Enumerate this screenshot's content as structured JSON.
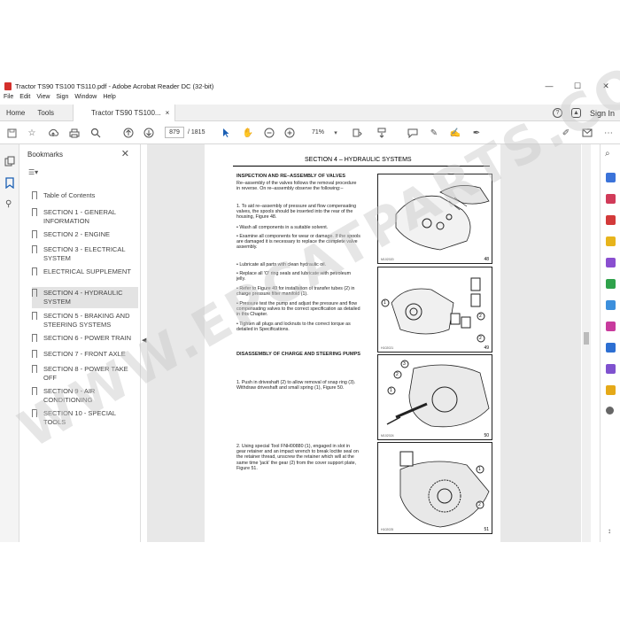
{
  "window": {
    "title": "Tractor TS90 TS100 TS110.pdf - Adobe Acrobat Reader DC (32-bit)",
    "controls": [
      "—",
      "☐",
      "✕"
    ]
  },
  "menu": [
    "File",
    "Edit",
    "View",
    "Sign",
    "Window",
    "Help"
  ],
  "tabs": {
    "home": "Home",
    "tools": "Tools",
    "doc": "Tractor TS90 TS100...",
    "close": "×",
    "sign_in": "Sign In"
  },
  "toolbar": {
    "page_current": "879",
    "page_total": "/ 1815",
    "zoom": "71%"
  },
  "bookmarks": {
    "title": "Bookmarks",
    "items": [
      "Table of Contents",
      "SECTION 1 - GENERAL INFORMATION",
      "SECTION 2 - ENGINE",
      "SECTION 3 - ELECTRICAL SYSTEM",
      "ELECTRICAL SUPPLEMENT",
      "SECTION 4 - HYDRAULIC SYSTEM",
      "SECTION 5 - BRAKING AND STEERING SYSTEMS",
      "SECTION 6 - POWER TRAIN",
      "SECTION 7 - FRONT AXLE",
      "SECTION 8 - POWER TAKE OFF",
      "SECTION 9 - AIR CONDITIONING",
      "SECTION 10 - SPECIAL TOOLS"
    ]
  },
  "page": {
    "section_title": "SECTION 4 – HYDRAULIC SYSTEMS",
    "heading1": "INSPECTION AND RE–ASSEMBLY OF VALVES",
    "intro": "Re–assembly of the valves follows the removal procedure in reverse. On re–assembly observe the following:–",
    "steps": [
      "1. To aid re–assembly of pressure and flow compensating valves, the spools should be inserted into the rear of the housing, Figure 48.",
      "• Wash all components in a suitable solvent.",
      "• Examine all components for wear or damage. If the spools are damaged it is necessary to replace the complete valve assembly.",
      "• Lubricate all parts with clean hydraulic oil.",
      "• Replace all 'O' ring seals and lubricate with petroleum jelly.",
      "• Refer to Figure 49 for installation of transfer tubes (2) in charge pressure filter manifold (1).",
      "• Pressure test the pump and adjust the pressure and flow compensating valves to the correct specification as detailed in this Chapter.",
      "• Tighten all plugs and locknuts to the correct torque as detailed in Specifications."
    ],
    "heading2": "DISASSEMBLY OF CHARGE AND STEERING PUMPS",
    "step_a": "1. Push in driveshaft (2) to allow removal of snap ring (3). Withdraw driveshaft and small spring (1), Figure 50.",
    "step_b": "2. Using special Tool FNH00880 (1), engaged in slot in gear retainer and an impact wrench to break loctite seal on the retainer thread, unscrew the retainer which will at the same time 'jack' the gear (2) from the cover support plate, Figure 51.",
    "figures": [
      "48",
      "49",
      "50",
      "51"
    ],
    "figure_codes": [
      "M102020",
      "H102021",
      "M102024",
      "H102025"
    ],
    "callouts_49": [
      "1",
      "2",
      "2"
    ],
    "callouts_50": [
      "1",
      "2",
      "3"
    ],
    "callouts_51": [
      "1",
      "2"
    ]
  },
  "watermark": "WWW.EPCATPARTS.COM"
}
